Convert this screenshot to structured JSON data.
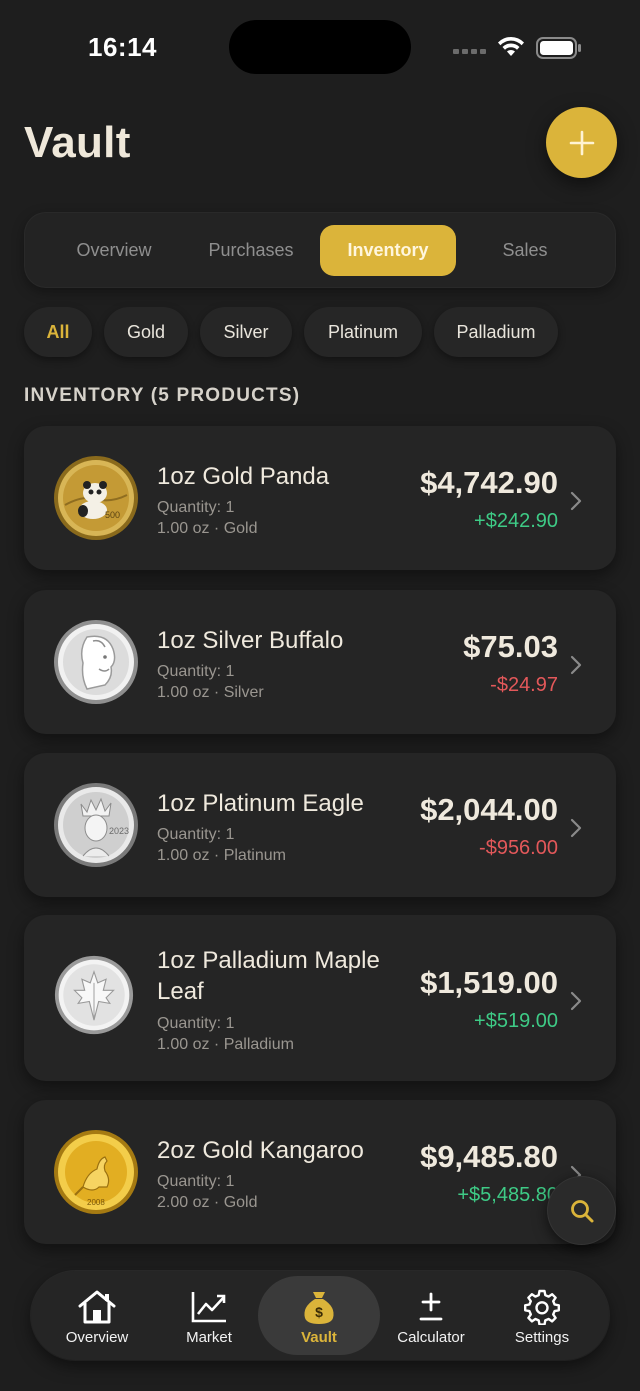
{
  "status_bar": {
    "time": "16:14"
  },
  "header": {
    "title": "Vault"
  },
  "segments": [
    {
      "label": "Overview"
    },
    {
      "label": "Purchases"
    },
    {
      "label": "Inventory"
    },
    {
      "label": "Sales"
    }
  ],
  "active_segment": "Inventory",
  "filters": [
    {
      "label": "All"
    },
    {
      "label": "Gold"
    },
    {
      "label": "Silver"
    },
    {
      "label": "Platinum"
    },
    {
      "label": "Palladium"
    }
  ],
  "active_filter": "All",
  "section_label": "INVENTORY (5 PRODUCTS)",
  "items": [
    {
      "name": "1oz Gold Panda",
      "quantity": "Quantity: 1",
      "detail": "1.00 oz · Gold",
      "value": "$4,742.90",
      "change": "+$242.90",
      "change_direction": "up",
      "coin_label": "500",
      "coin_color": "#c9a23a"
    },
    {
      "name": "1oz Silver Buffalo",
      "quantity": "Quantity: 1",
      "detail": "1.00 oz · Silver",
      "value": "$75.03",
      "change": "-$24.97",
      "change_direction": "down",
      "coin_color": "#cfcfcf"
    },
    {
      "name": "1oz Platinum Eagle",
      "quantity": "Quantity: 1",
      "detail": "1.00 oz · Platinum",
      "value": "$2,044.00",
      "change": "-$956.00",
      "change_direction": "down",
      "coin_label": "2023",
      "coin_color": "#d9d9d9"
    },
    {
      "name": "1oz Palladium Maple Leaf",
      "quantity": "Quantity: 1",
      "detail": "1.00 oz · Palladium",
      "value": "$1,519.00",
      "change": "+$519.00",
      "change_direction": "up",
      "coin_color": "#e0e0e0"
    },
    {
      "name": "2oz Gold Kangaroo",
      "quantity": "Quantity: 1",
      "detail": "2.00 oz · Gold",
      "value": "$9,485.80",
      "change": "+$5,485.80",
      "change_direction": "up",
      "coin_label": "2008",
      "coin_color": "#e3b52a"
    }
  ],
  "tab_bar": [
    {
      "label": "Overview",
      "icon": "home-icon"
    },
    {
      "label": "Market",
      "icon": "chart-icon"
    },
    {
      "label": "Vault",
      "icon": "money-bag-icon"
    },
    {
      "label": "Calculator",
      "icon": "plus-minus-icon"
    },
    {
      "label": "Settings",
      "icon": "gear-icon"
    }
  ],
  "active_tab": "Vault",
  "colors": {
    "accent": "#dbb43a",
    "positive": "#3ecb86",
    "negative": "#e3585a",
    "background": "#1e1e1e",
    "card": "#252525"
  }
}
